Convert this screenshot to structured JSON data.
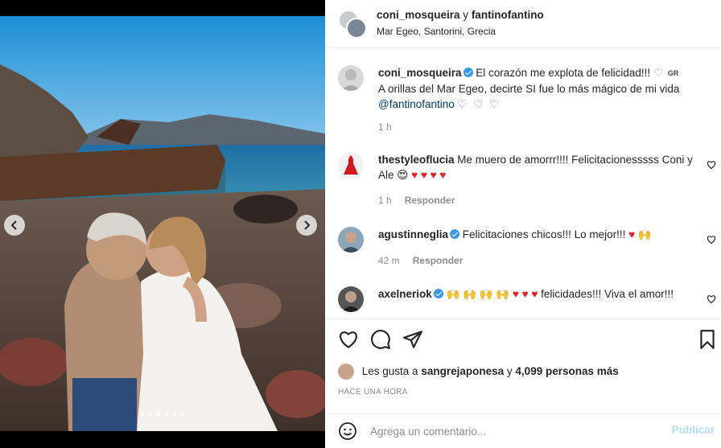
{
  "header": {
    "user1": "coni_mosqueira",
    "conj": "y",
    "user2": "fantinofantino",
    "location": "Mar Egeo, Santorini, Grecia"
  },
  "caption": {
    "user": "coni_mosqueira",
    "line1": "El corazón me explota de felicidad!!!",
    "flag": "GR",
    "line2": "A orillas del Mar Egeo, decirte SI fue lo más mágico de mi vida",
    "mention": "@fantinofantino",
    "hearts": "♡ ♡ ♡",
    "time": "1 h"
  },
  "comments": [
    {
      "user": "thestyleoflucia",
      "text": "Me muero de amorrr!!!! Felicitacionesssss Coni y Ale",
      "emoji": "😍",
      "hearts": "♥ ♥ ♥ ♥",
      "time": "1 h",
      "reply": "Responder"
    },
    {
      "user": "agustinneglia",
      "text": "Felicitaciones chicos!!! Lo mejor!!!",
      "emoji_end": "♥ 🙌",
      "time": "42 m",
      "reply": "Responder"
    },
    {
      "user": "axelneriok",
      "pre": "🙌 🙌 🙌 🙌",
      "hearts": "♥ ♥ ♥",
      "text": "felicidades!!! Viva el amor!!!"
    }
  ],
  "likes": {
    "prefix": "Les gusta a",
    "user": "sangrejaponesa",
    "conj": "y",
    "count": "4,099 personas más"
  },
  "timestamp": "HACE UNA HORA",
  "add_comment": {
    "placeholder": "Agrega un comentario...",
    "publish": "Publicar"
  },
  "carousel": {
    "total": 6,
    "active": 3
  },
  "colors": {
    "verified": "#3897f0",
    "heart_red": "#ed1c24",
    "publish_disabled": "#b2dffc"
  }
}
